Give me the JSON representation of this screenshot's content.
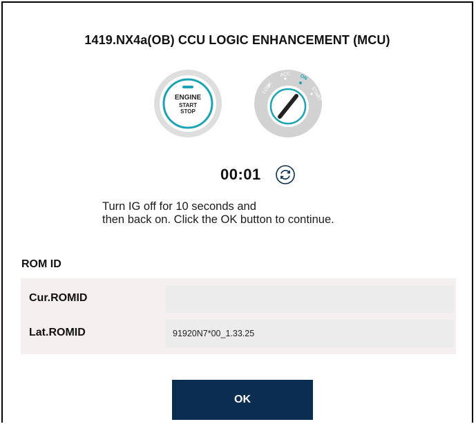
{
  "dialog": {
    "title": "1419.NX4a(OB) CCU LOGIC ENHANCEMENT (MCU)",
    "start_button": {
      "line1": "ENGINE",
      "line2": "START",
      "line3": "STOP"
    },
    "ignition_key": {
      "positions": [
        "LOCK",
        "ACC",
        "ON",
        "START"
      ]
    },
    "timer": "00:01",
    "instruction_lines": [
      "Turn IG off for 10 seconds and",
      "then back on. Click the OK button to continue."
    ],
    "rom_id": {
      "heading": "ROM ID",
      "rows": [
        {
          "label": "Cur.ROMID",
          "value": ""
        },
        {
          "label": "Lat.ROMID",
          "value": "91920N7*00_1.33.25"
        }
      ]
    },
    "ok_label": "OK"
  },
  "colors": {
    "accent_teal": "#1aa3b5",
    "ok_button_bg": "#0b2d52",
    "panel_bg": "#f5efef",
    "field_bg": "#ececec",
    "icon_ring": "#d7d7d7"
  }
}
